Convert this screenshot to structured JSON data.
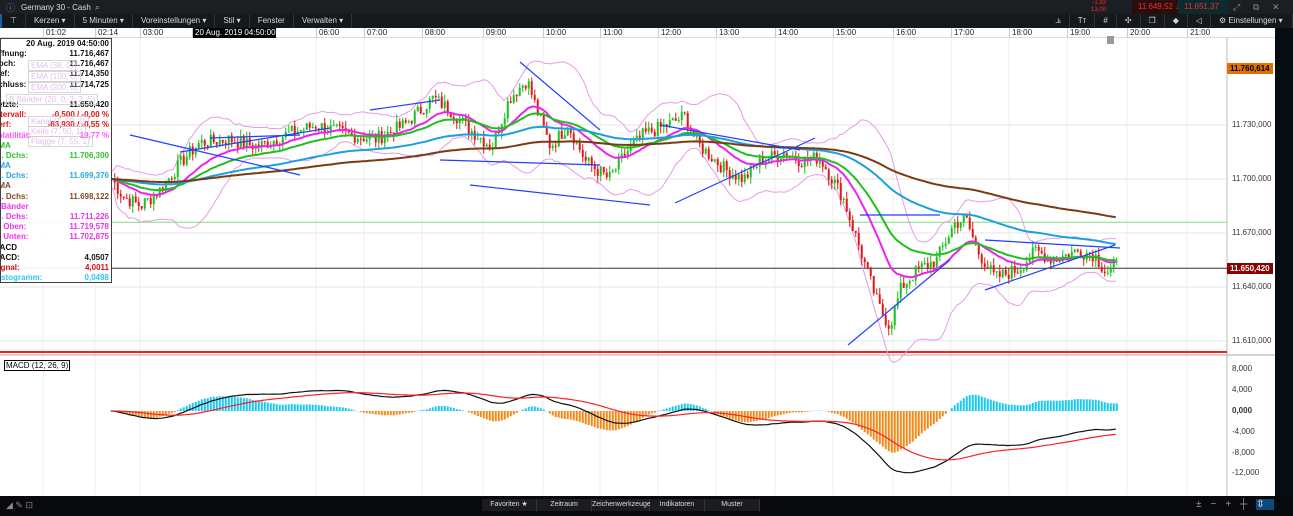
{
  "header": {
    "title": "Germany 30 - Cash",
    "quote_small_1": "-1,93",
    "quote_small_2": "13,00",
    "bid": "11.649,52",
    "ask": "11.651,37"
  },
  "toolbar": {
    "items": [
      "Kerzen ▾",
      "5 Minuten ▾",
      "Voreinstellungen ▾",
      "Stil ▾",
      "Fenster",
      "Verwalten ▾"
    ],
    "settings": "Einstellungen ▾"
  },
  "time_axis": {
    "labels": [
      "01:02",
      "02:14",
      "03:00",
      "06:00",
      "07:00",
      "08:00",
      "09:00",
      "10:00",
      "11:00",
      "12:00",
      "13:00",
      "14:00",
      "15:00",
      "16:00",
      "17:00",
      "18:00",
      "19:00",
      "20:00",
      "21:00"
    ],
    "cursor_label": "20 Aug. 2019 04:50:00"
  },
  "info_panel": {
    "date": "20 Aug. 2019 04:50:00",
    "rows": [
      {
        "label": "Öffnung:",
        "value": "11.716,467",
        "color": "#000"
      },
      {
        "label": "Hoch:",
        "value": "11.716,467",
        "color": "#000"
      },
      {
        "label": "Tief:",
        "value": "11.714,350",
        "color": "#000"
      },
      {
        "label": "Schluss:",
        "value": "11.714,725",
        "color": "#000"
      },
      {
        "label": "",
        "value": "",
        "color": "#000"
      },
      {
        "label": "Letzte:",
        "value": "11.650,420",
        "color": "#000"
      },
      {
        "label": "Intervall:",
        "value": "-0,500 / -0,00 %",
        "color": "#e00000"
      },
      {
        "label": "Perf:",
        "value": "-63,930 / -0,55 %",
        "color": "#e00000"
      },
      {
        "label": "Volatilität:",
        "value": "19,77 %",
        "color": "#ff44ff"
      },
      {
        "label": "EMA",
        "value": "",
        "color": "#1fbf1f"
      },
      {
        "label": "Gl. Dchs:",
        "value": "11.706,300",
        "color": "#1fbf1f"
      },
      {
        "label": "EMA",
        "value": "",
        "color": "#1aa0e0"
      },
      {
        "label": "Gl. Dchs:",
        "value": "11.699,376",
        "color": "#1aa0e0"
      },
      {
        "label": "EMA",
        "value": "",
        "color": "#7a3b12"
      },
      {
        "label": "Gl. Dchs:",
        "value": "11.698,122",
        "color": "#7a3b12"
      },
      {
        "label": "B Bänder",
        "value": "",
        "color": "#ee22ee"
      },
      {
        "label": "Gl. Dchs:",
        "value": "11.711,226",
        "color": "#ee22ee"
      },
      {
        "label": "B. Oben:",
        "value": "11.719,578",
        "color": "#ee22ee"
      },
      {
        "label": "B. Unten:",
        "value": "11.702,875",
        "color": "#ee22ee"
      },
      {
        "label": "MACD",
        "value": "",
        "color": "#000"
      },
      {
        "label": "MACD:",
        "value": "4,0507",
        "color": "#000"
      },
      {
        "label": "Signal:",
        "value": "4,0011",
        "color": "#e00000"
      },
      {
        "label": "Histogramm:",
        "value": "0,0498",
        "color": "#1ac8ee"
      }
    ],
    "legend": [
      "EMA (38, 0)",
      "EMA (100, 0)",
      "EMA (200, 0)",
      "B Bänder (20, 0, 2, 2, S)",
      "Kanal (7, 50, 1)",
      "Keile (7, 50, 1)",
      "Flagge (7, 55, 1)"
    ]
  },
  "price_axis": {
    "labels": [
      "11.730,000",
      "11.700,000",
      "11.670,000",
      "11.640,000",
      "11.610,000"
    ],
    "high_marker": "11.760,614",
    "last_price": "11.650,420"
  },
  "macd_panel": {
    "title": "MACD (12, 26, 9)",
    "labels": [
      "8,000",
      "4,000",
      "0,000",
      "-4,000",
      "-8,000",
      "-12,000"
    ]
  },
  "bottom_bar": {
    "tabs": [
      "Favoriten ★",
      "Zeitraum",
      "Zeichenwerkzeuge",
      "Indikatoren",
      "Muster"
    ]
  },
  "colors": {
    "up": "#1fbf1f",
    "down": "#e21818",
    "ema38": "#1fbf1f",
    "ema100": "#1aa0e0",
    "ema200": "#7a3b12",
    "boll": "#ee22ee",
    "macd_hist_pos": "#1ac8ee",
    "macd_hist_neg": "#f08a1a",
    "orange": "#e07000",
    "last": "#8b0000"
  },
  "chart_data": {
    "type": "candlestick",
    "series_close": [
      [
        2.5,
        11700
      ],
      [
        2.7,
        11690
      ],
      [
        3.0,
        11685
      ],
      [
        3.3,
        11693
      ],
      [
        3.7,
        11710
      ],
      [
        4.0,
        11720
      ],
      [
        4.5,
        11722
      ],
      [
        5.0,
        11718
      ],
      [
        5.5,
        11725
      ],
      [
        6.0,
        11730
      ],
      [
        6.5,
        11725
      ],
      [
        7.0,
        11722
      ],
      [
        7.5,
        11730
      ],
      [
        8.0,
        11745
      ],
      [
        8.3,
        11738
      ],
      [
        8.6,
        11728
      ],
      [
        9.0,
        11718
      ],
      [
        9.3,
        11745
      ],
      [
        9.6,
        11755
      ],
      [
        9.8,
        11735
      ],
      [
        10.0,
        11718
      ],
      [
        10.3,
        11730
      ],
      [
        10.6,
        11710
      ],
      [
        11.0,
        11700
      ],
      [
        11.3,
        11715
      ],
      [
        11.6,
        11725
      ],
      [
        12.0,
        11730
      ],
      [
        12.3,
        11735
      ],
      [
        12.5,
        11720
      ],
      [
        13.0,
        11705
      ],
      [
        13.3,
        11700
      ],
      [
        13.6,
        11710
      ],
      [
        14.0,
        11715
      ],
      [
        14.3,
        11710
      ],
      [
        14.6,
        11712
      ],
      [
        15.0,
        11690
      ],
      [
        15.3,
        11660
      ],
      [
        15.6,
        11630
      ],
      [
        15.8,
        11618
      ],
      [
        16.0,
        11640
      ],
      [
        16.3,
        11650
      ],
      [
        16.6,
        11655
      ],
      [
        16.9,
        11675
      ],
      [
        17.1,
        11678
      ],
      [
        17.3,
        11660
      ],
      [
        17.6,
        11645
      ],
      [
        18.0,
        11650
      ],
      [
        18.3,
        11660
      ],
      [
        18.6,
        11655
      ],
      [
        19.0,
        11660
      ],
      [
        19.3,
        11658
      ],
      [
        19.5,
        11648
      ],
      [
        19.7,
        11652
      ]
    ],
    "ylim": [
      11600,
      11775
    ],
    "hlines": [
      11676,
      11650.42,
      11605
    ],
    "macd_ylim": [
      -14,
      9
    ]
  }
}
